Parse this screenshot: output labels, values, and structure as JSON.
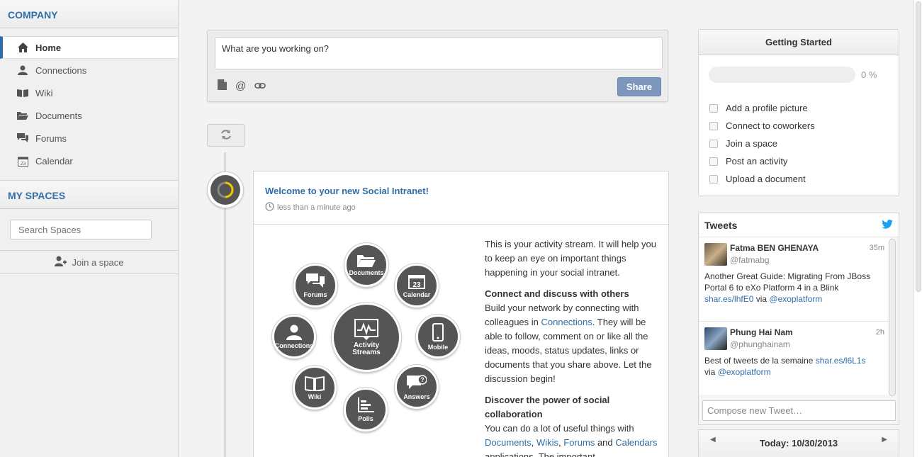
{
  "sidebar": {
    "company_title": "COMPANY",
    "items": [
      {
        "label": "Home",
        "icon": "home-icon"
      },
      {
        "label": "Connections",
        "icon": "user-icon"
      },
      {
        "label": "Wiki",
        "icon": "book-icon"
      },
      {
        "label": "Documents",
        "icon": "folder-icon"
      },
      {
        "label": "Forums",
        "icon": "chat-icon"
      },
      {
        "label": "Calendar",
        "icon": "calendar-icon"
      }
    ],
    "spaces_title": "MY SPACES",
    "search_placeholder": "Search Spaces",
    "join_label": "Join a space"
  },
  "composer": {
    "placeholder": "What are you working on?",
    "share_label": "Share"
  },
  "activity": {
    "title": "Welcome to your new Social Intranet!",
    "time": "less than a minute ago",
    "bubbles": {
      "documents": "Documents",
      "forums": "Forums",
      "calendar": "Calendar",
      "calendar_day": "23",
      "connections": "Connections",
      "activity": "Activity\nStreams",
      "mobile": "Mobile",
      "wiki": "Wiki",
      "answers": "Answers",
      "polls": "Polls"
    },
    "p1": "This is your activity stream. It will help you to keep an eye on important things happening in your social intranet.",
    "h2": "Connect and discuss with others",
    "p2a": "Build your network by connecting with colleagues in ",
    "p2link": "Connections",
    "p2b": ". They will be able to follow, comment on or like all the ideas, moods, status updates, links or documents that you share above. Let the discussion begin!",
    "h3": "Discover the power of social collaboration",
    "p3a": "You can do a lot of useful things with ",
    "l_docs": "Documents",
    "l_wikis": "Wikis",
    "l_forums": "Forums",
    "p3and": " and ",
    "l_cal": "Calendars",
    "p3b": " applications. The important"
  },
  "getting_started": {
    "title": "Getting Started",
    "progress": "0 %",
    "tasks": [
      "Add a profile picture",
      "Connect to coworkers",
      "Join a space",
      "Post an activity",
      "Upload a document"
    ]
  },
  "tweets": {
    "title": "Tweets",
    "items": [
      {
        "name": "Fatma BEN GHENAYA",
        "handle": "@fatmabg",
        "age": "35m",
        "text": "Another Great Guide: Migrating From JBoss Portal 6 to eXo Platform 4 in a Blink",
        "link": "shar.es/lhfE0",
        "via": " via ",
        "mention": "@exoplatform"
      },
      {
        "name": "Phung Hai Nam",
        "handle": "@phunghainam",
        "age": "2h",
        "text": "Best of tweets de la semaine ",
        "link": "shar.es/l6L1s",
        "via": "via ",
        "mention": "@exoplatform"
      }
    ],
    "compose_placeholder": "Compose new Tweet…"
  },
  "calendar": {
    "label": "Today: 10/30/2013"
  },
  "colors": {
    "accent": "#2f6ea8",
    "share_button": "#7d97bc",
    "twitter": "#1da1f2"
  }
}
